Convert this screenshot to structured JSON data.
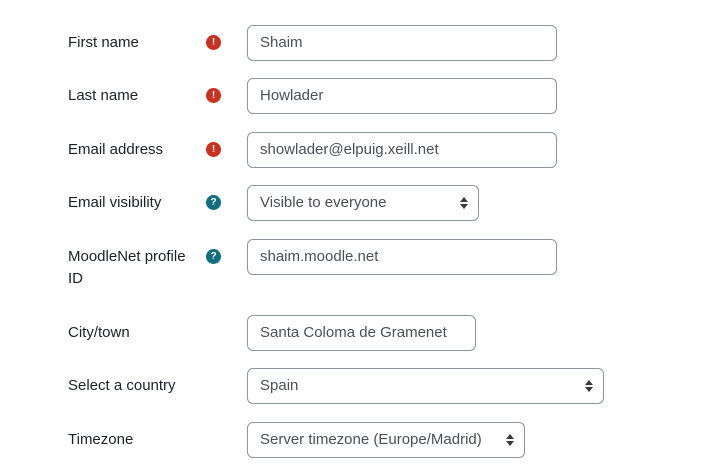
{
  "fields": {
    "first_name": {
      "label": "First name",
      "value": "Shaim",
      "icon": "required-icon"
    },
    "last_name": {
      "label": "Last name",
      "value": "Howlader",
      "icon": "required-icon"
    },
    "email": {
      "label": "Email address",
      "value": "showlader@elpuig.xeill.net",
      "icon": "required-icon"
    },
    "email_visibility": {
      "label": "Email visibility",
      "value": "Visible to everyone",
      "icon": "help-icon"
    },
    "moodlenet": {
      "label": "MoodleNet profile ID",
      "value": "shaim.moodle.net",
      "icon": "help-icon"
    },
    "city": {
      "label": "City/town",
      "value": "Santa Coloma de Gramenet"
    },
    "country": {
      "label": "Select a country",
      "value": "Spain"
    },
    "timezone": {
      "label": "Timezone",
      "value": "Server timezone (Europe/Madrid)"
    }
  },
  "icons": {
    "required_glyph": "!",
    "help_glyph": "?"
  },
  "colors": {
    "required": "#ca3120",
    "help": "#0f6f81"
  }
}
